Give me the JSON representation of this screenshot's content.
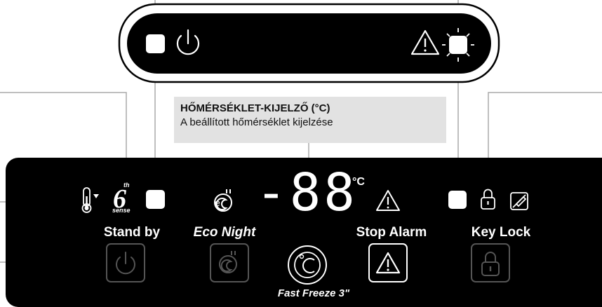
{
  "callout": {
    "title": "HŐMÉRSÉKLET-KIJELZŐ (°C)",
    "description": "A beállított hőmérséklet kijelzése"
  },
  "panel": {
    "sixth_sense_number": "6",
    "sixth_sense_sup": "th",
    "sixth_sense_sub": "sense",
    "stand_by_label": "Stand by",
    "eco_night_label": "Eco Night",
    "temperature_display": "-88",
    "temperature_unit": "°C",
    "stop_alarm_label": "Stop Alarm",
    "key_lock_label": "Key Lock",
    "fast_freeze_label": "Fast Freeze 3\""
  },
  "icons": [
    "power-icon",
    "alarm-warning-icon",
    "thermometer-icon",
    "eco-plug-icon",
    "padlock-icon",
    "no-edit-icon",
    "fast-freeze-celsius-icon"
  ],
  "colors": {
    "panel": "#000000",
    "led": "#ffffff",
    "button_border": "#555555",
    "callout_bg": "#e2e2e2"
  }
}
